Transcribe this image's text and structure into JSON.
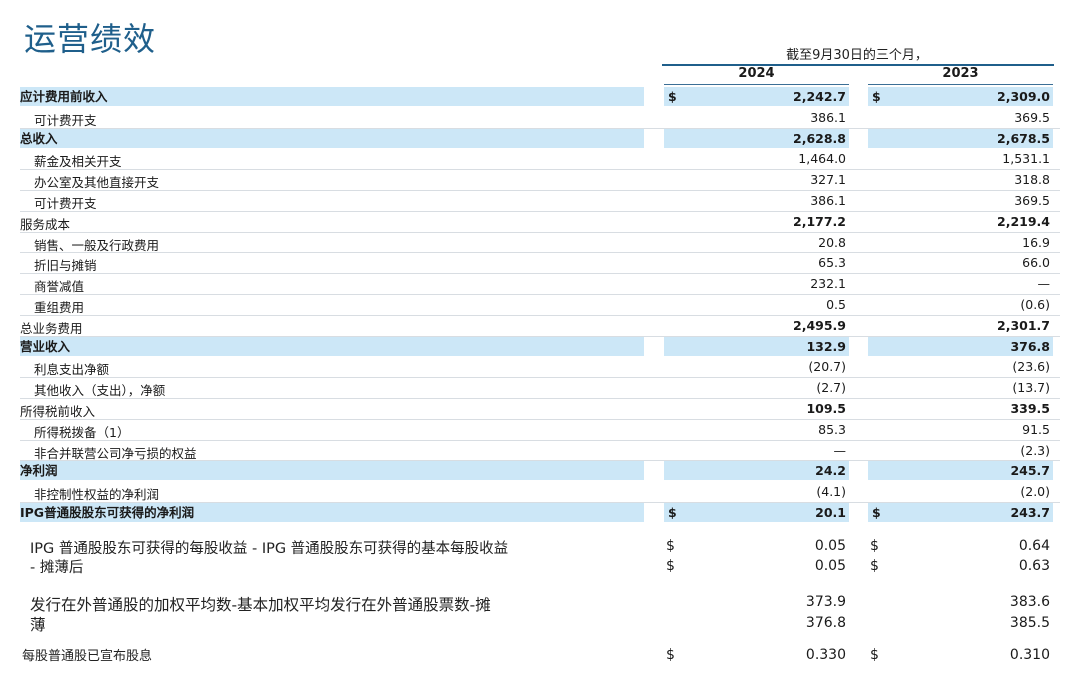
{
  "title": "运营绩效",
  "period": "截至9月30日的三个月，",
  "years": [
    "2024",
    "2023"
  ],
  "rows": [
    {
      "label": "应计费用前收入",
      "v24": "2,242.7",
      "v23": "2,309.0",
      "cur24": "$",
      "cur23": "$",
      "style": "hl bold"
    },
    {
      "label": "可计费开支",
      "v24": "386.1",
      "v23": "369.5",
      "cur24": "",
      "cur23": "",
      "style": "sub"
    },
    {
      "label": "总收入",
      "v24": "2,628.8",
      "v23": "2,678.5",
      "cur24": "",
      "cur23": "",
      "style": "hl bold"
    },
    {
      "label": "薪金及相关开支",
      "v24": "1,464.0",
      "v23": "1,531.1",
      "cur24": "",
      "cur23": "",
      "style": "sub"
    },
    {
      "label": "办公室及其他直接开支",
      "v24": "327.1",
      "v23": "318.8",
      "cur24": "",
      "cur23": "",
      "style": "sub"
    },
    {
      "label": "可计费开支",
      "v24": "386.1",
      "v23": "369.5",
      "cur24": "",
      "cur23": "",
      "style": "sub"
    },
    {
      "label": "服务成本",
      "v24": "2,177.2",
      "v23": "2,219.4",
      "cur24": "",
      "cur23": "",
      "style": "bold"
    },
    {
      "label": "销售、一般及行政费用",
      "v24": "20.8",
      "v23": "16.9",
      "cur24": "",
      "cur23": "",
      "style": "sub"
    },
    {
      "label": "折旧与摊销",
      "v24": "65.3",
      "v23": "66.0",
      "cur24": "",
      "cur23": "",
      "style": "sub"
    },
    {
      "label": "商誉减值",
      "v24": "232.1",
      "v23": "—",
      "cur24": "",
      "cur23": "",
      "style": "sub"
    },
    {
      "label": "重组费用",
      "v24": "0.5",
      "v23": "(0.6)",
      "cur24": "",
      "cur23": "",
      "style": "sub"
    },
    {
      "label": "总业务费用",
      "v24": "2,495.9",
      "v23": "2,301.7",
      "cur24": "",
      "cur23": "",
      "style": "bold"
    },
    {
      "label": "营业收入",
      "v24": "132.9",
      "v23": "376.8",
      "cur24": "",
      "cur23": "",
      "style": "hl bold"
    },
    {
      "label": "利息支出净额",
      "v24": "(20.7)",
      "v23": "(23.6)",
      "cur24": "",
      "cur23": "",
      "style": "sub"
    },
    {
      "label": "其他收入（支出），净额",
      "v24": "(2.7)",
      "v23": "(13.7)",
      "cur24": "",
      "cur23": "",
      "style": "sub"
    },
    {
      "label": "所得税前收入",
      "v24": "109.5",
      "v23": "339.5",
      "cur24": "",
      "cur23": "",
      "style": "bold"
    },
    {
      "label": "所得税拨备（1）",
      "v24": "85.3",
      "v23": "91.5",
      "cur24": "",
      "cur23": "",
      "style": "sub"
    },
    {
      "label": "非合并联营公司净亏损的权益",
      "v24": "—",
      "v23": "(2.3)",
      "cur24": "",
      "cur23": "",
      "style": "sub"
    },
    {
      "label": "净利润",
      "v24": "24.2",
      "v23": "245.7",
      "cur24": "",
      "cur23": "",
      "style": "hl bold"
    },
    {
      "label": "非控制性权益的净利润",
      "v24": "(4.1)",
      "v23": "(2.0)",
      "cur24": "",
      "cur23": "",
      "style": "sub"
    },
    {
      "label": "IPG普通股股东可获得的净利润",
      "v24": "20.1",
      "v23": "243.7",
      "cur24": "$",
      "cur23": "$",
      "style": "hl bold"
    }
  ],
  "eps": {
    "label_line1": "IPG 普通股股东可获得的每股收益 - IPG 普通股股东可获得的基本每股收益",
    "label_line2": "- 摊薄后",
    "basic24": "0.05",
    "basic23": "0.64",
    "diluted24": "0.05",
    "diluted23": "0.63",
    "cur": "$"
  },
  "shares": {
    "label_line1": "发行在外普通股的加权平均数-基本加权平均发行在外普通股票数-摊",
    "label_line2": "薄",
    "basic24": "373.9",
    "basic23": "383.6",
    "diluted24": "376.8",
    "diluted23": "385.5"
  },
  "dividend": {
    "label": "每股普通股已宣布股息",
    "v24": "0.330",
    "v23": "0.310",
    "cur": "$"
  }
}
